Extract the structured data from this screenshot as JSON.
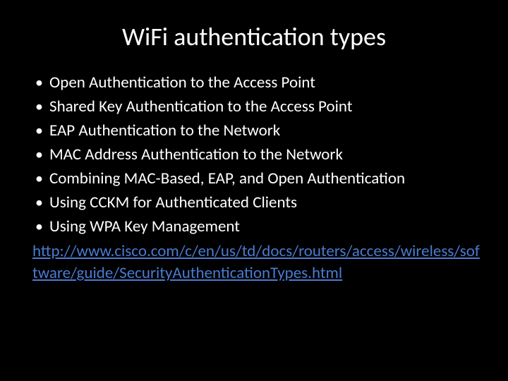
{
  "title": "WiFi authentication types",
  "bullets": [
    "Open Authentication to the Access Point",
    "Shared Key Authentication to the Access Point",
    "EAP Authentication to the Network",
    "MAC Address Authentication to the Network",
    "Combining MAC-Based, EAP, and Open Authentication",
    "Using CCKM for Authenticated Clients",
    "Using WPA Key Management"
  ],
  "link_text": "http://www.cisco.com/c/en/us/td/docs/routers/access/wireless/software/guide/SecurityAuthenticationTypes.html"
}
